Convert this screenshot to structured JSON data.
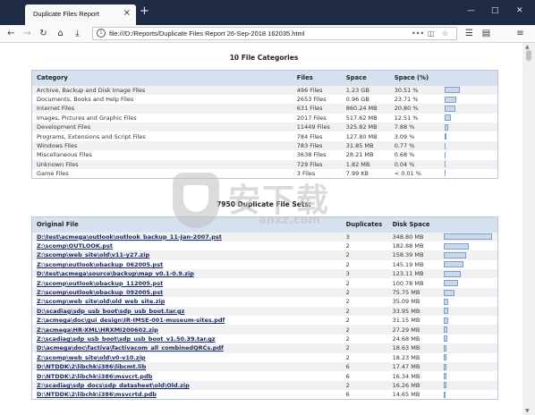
{
  "browser": {
    "tab_title": "Duplicate Files Report",
    "tab_close": "×",
    "new_tab": "+",
    "url": "file:///D:/Reports/Duplicate Files Report 26-Sep-2018 162035.html",
    "icons": {
      "back": "back-arrow-icon",
      "forward": "forward-arrow-icon",
      "reload": "reload-icon",
      "home": "home-icon",
      "download": "download-icon",
      "info": "info-icon",
      "more": "more-dots-icon",
      "pocket": "pocket-icon",
      "star": "bookmark-star-icon",
      "menu": "hamburger-menu-icon",
      "minimize": "minimize-icon",
      "maximize": "maximize-icon",
      "close": "close-icon"
    }
  },
  "report": {
    "categories_title": "10 File Categories",
    "categories_headers": {
      "category": "Category",
      "files": "Files",
      "space": "Space",
      "space_pct": "Space (%)"
    },
    "categories": [
      {
        "name": "Archive, Backup and Disk Image Files",
        "files": "496 Files",
        "space": "1.23 GB",
        "pct": "30.51 %",
        "fill": 0.3051
      },
      {
        "name": "Documents, Books and Help Files",
        "files": "2653 Files",
        "space": "0.96 GB",
        "pct": "23.71 %",
        "fill": 0.2371
      },
      {
        "name": "Internet Files",
        "files": "631 Files",
        "space": "860.24 MB",
        "pct": "20.80 %",
        "fill": 0.208
      },
      {
        "name": "Images, Pictures and Graphic Files",
        "files": "2017 Files",
        "space": "517.62 MB",
        "pct": "12.51 %",
        "fill": 0.1251
      },
      {
        "name": "Development Files",
        "files": "11449 Files",
        "space": "325.82 MB",
        "pct": "7.88 %",
        "fill": 0.0788
      },
      {
        "name": "Programs, Extensions and Script Files",
        "files": "784 Files",
        "space": "127.80 MB",
        "pct": "3.09 %",
        "fill": 0.0309
      },
      {
        "name": "Windows Files",
        "files": "783 Files",
        "space": "31.85 MB",
        "pct": "0.77 %",
        "fill": 0.0077
      },
      {
        "name": "Miscellaneous Files",
        "files": "3638 Files",
        "space": "28.21 MB",
        "pct": "0.68 %",
        "fill": 0.0068
      },
      {
        "name": "Unknown Files",
        "files": "729 Files",
        "space": "1.82 MB",
        "pct": "0.04 %",
        "fill": 0.0004
      },
      {
        "name": "Game Files",
        "files": "3 Files",
        "space": "7.99 KB",
        "pct": "< 0.01 %",
        "fill": 0
      }
    ],
    "duplicates_title": "7950 Duplicate File Sets:",
    "duplicates_headers": {
      "original": "Original File",
      "duplicates": "Duplicates",
      "disk_space": "Disk Space"
    },
    "duplicates": [
      {
        "path": "D:\\test\\acmega\\outlook\\outlook_backup_11-Jan-2007.pst",
        "dups": "3",
        "space": "348.80 MB",
        "fill": 1.0
      },
      {
        "path": "Z:\\scomp\\OUTLOOK.pst",
        "dups": "2",
        "space": "182.88 MB",
        "fill": 0.524
      },
      {
        "path": "Z:\\scomp\\web_site\\old\\v11-y27.zip",
        "dups": "2",
        "space": "158.39 MB",
        "fill": 0.454
      },
      {
        "path": "Z:\\scomp\\outlook\\obackup_062005.pst",
        "dups": "2",
        "space": "145.19 MB",
        "fill": 0.416
      },
      {
        "path": "D:\\test\\acmega\\source\\backup\\map_v0.1-0.9.zip",
        "dups": "3",
        "space": "123.11 MB",
        "fill": 0.353
      },
      {
        "path": "Z:\\scomp\\outlook\\obackup_112005.pst",
        "dups": "2",
        "space": "100.78 MB",
        "fill": 0.289
      },
      {
        "path": "Z:\\scomp\\outlook\\obackup_092005.pst",
        "dups": "2",
        "space": "75.75 MB",
        "fill": 0.217
      },
      {
        "path": "Z:\\scomp\\web_site\\old\\old_web_site.zip",
        "dups": "2",
        "space": "35.09 MB",
        "fill": 0.101
      },
      {
        "path": "D:\\scadiag\\sdp_usb_boot\\sdp_usb_boot.tar.gz",
        "dups": "2",
        "space": "33.95 MB",
        "fill": 0.097
      },
      {
        "path": "Z:\\acmega\\doc\\gui_design\\IR-IMSE-001-museum-sites.pdf",
        "dups": "2",
        "space": "31.15 MB",
        "fill": 0.089
      },
      {
        "path": "Z:\\acmega\\HR-XML\\HRXMI200602.zip",
        "dups": "2",
        "space": "27.29 MB",
        "fill": 0.078
      },
      {
        "path": "Z:\\scadiag\\sdp_usb_boot\\sdp_usb_boot_v1.50.39.tar.gz",
        "dups": "2",
        "space": "24.68 MB",
        "fill": 0.071
      },
      {
        "path": "D:\\acmega\\doc\\factiva\\factivacom_all_combinedQRCs.pdf",
        "dups": "2",
        "space": "18.63 MB",
        "fill": 0.053
      },
      {
        "path": "Z:\\scomp\\web_site\\old\\v0-v10.zip",
        "dups": "2",
        "space": "18.23 MB",
        "fill": 0.052
      },
      {
        "path": "D:\\NTDDK\\2\\libchk\\i386\\libcmt.lib",
        "dups": "6",
        "space": "17.47 MB",
        "fill": 0.05
      },
      {
        "path": "D:\\NTDDK\\2\\libchk\\i386\\msvcrt.pdb",
        "dups": "6",
        "space": "16.34 MB",
        "fill": 0.047
      },
      {
        "path": "Z:\\scadiag\\sdp_docs\\sdp_datasheet\\old\\Old.zip",
        "dups": "2",
        "space": "16.26 MB",
        "fill": 0.047
      },
      {
        "path": "D:\\NTDDK\\2\\libchk\\i386\\msvcrtd.pdb",
        "dups": "6",
        "space": "14.65 MB",
        "fill": 0.042
      }
    ]
  },
  "watermark": {
    "cn": "安下载",
    "en": "anxz.com"
  }
}
